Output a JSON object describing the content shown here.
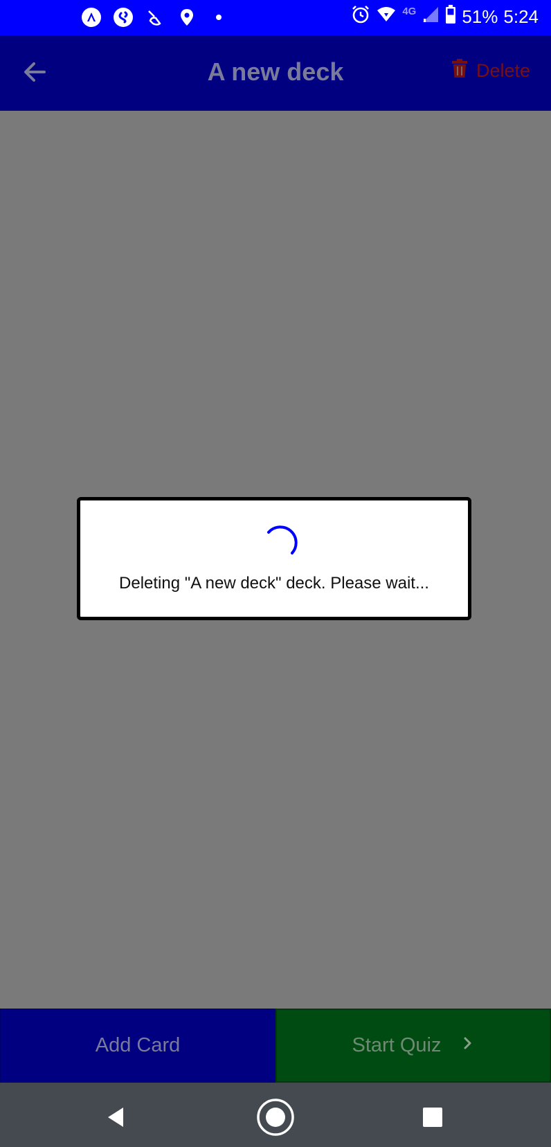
{
  "status_bar": {
    "battery_percent": "51%",
    "time": "5:24",
    "network_label": "4G",
    "left_icons": [
      "app-icon",
      "shazam-icon",
      "brush-icon",
      "location-icon",
      "dot-icon"
    ],
    "right_icons": [
      "alarm-icon",
      "wifi-icon",
      "signal-icon",
      "battery-icon"
    ]
  },
  "app_bar": {
    "title": "A new deck",
    "delete_label": "Delete"
  },
  "dialog": {
    "message": "Deleting \"A new deck\" deck. Please wait..."
  },
  "bottom_bar": {
    "add_card_label": "Add Card",
    "start_quiz_label": "Start Quiz"
  },
  "colors": {
    "status_bar": "#0000ff",
    "app_bar": "#000080",
    "overlay": "#7a7a7a",
    "start_quiz": "#004b12",
    "spinner": "#0000ff",
    "delete": "#7a0f10",
    "nav_bar": "#444a4f"
  }
}
